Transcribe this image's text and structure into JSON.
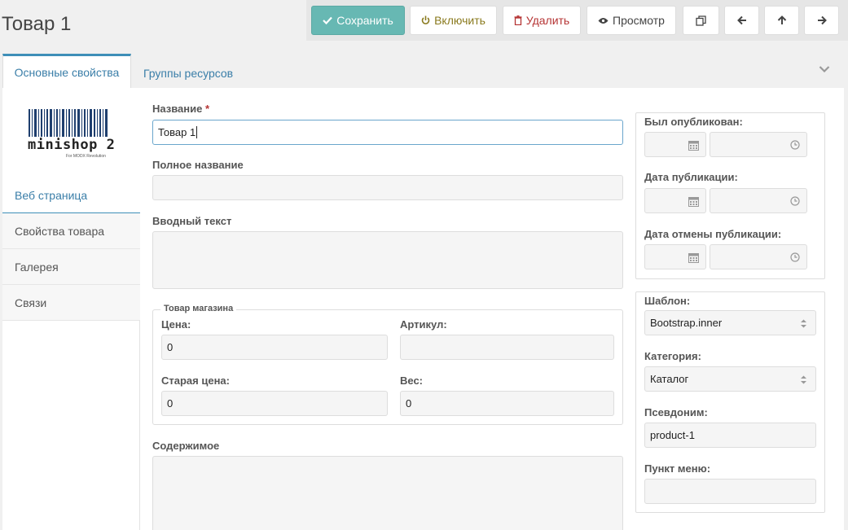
{
  "page": {
    "title": "Товар 1"
  },
  "toolbar": {
    "save": "Сохранить",
    "enable": "Включить",
    "delete": "Удалить",
    "preview": "Просмотр",
    "icons": [
      "duplicate-icon",
      "arrow-left-icon",
      "arrow-up-icon",
      "arrow-right-icon"
    ]
  },
  "tabs": [
    {
      "label": "Основные свойства"
    },
    {
      "label": "Группы ресурсов"
    }
  ],
  "logo": {
    "name": "minishop 2",
    "sub": "For MODX Revolution"
  },
  "sidebar": {
    "items": [
      {
        "label": "Веб страница"
      },
      {
        "label": "Свойства товара"
      },
      {
        "label": "Галерея"
      },
      {
        "label": "Связи"
      }
    ]
  },
  "form": {
    "name": {
      "label": "Название",
      "required": "*",
      "value": "Товар 1"
    },
    "longtitle": {
      "label": "Полное название",
      "value": ""
    },
    "introtext": {
      "label": "Вводный текст",
      "value": ""
    },
    "shop": {
      "legend": "Товар магазина",
      "price": {
        "label": "Цена:",
        "value": "0"
      },
      "article": {
        "label": "Артикул:",
        "value": ""
      },
      "old_price": {
        "label": "Старая цена:",
        "value": "0"
      },
      "weight": {
        "label": "Вес:",
        "value": "0"
      }
    },
    "content": {
      "label": "Содержимое",
      "value": ""
    }
  },
  "dates": {
    "published": {
      "label": "Был опубликован:"
    },
    "pub_date": {
      "label": "Дата публикации:"
    },
    "unpub_date": {
      "label": "Дата отмены публикации:"
    }
  },
  "settings": {
    "template": {
      "label": "Шаблон:",
      "value": "Bootstrap.inner"
    },
    "category": {
      "label": "Категория:",
      "value": "Каталог"
    },
    "alias": {
      "label": "Псевдоним:",
      "value": "product-1"
    },
    "menutitle": {
      "label": "Пункт меню:",
      "value": ""
    }
  },
  "colors": {
    "accent": "#67b8b3",
    "link": "#3a7ea8",
    "danger": "#b53434"
  }
}
